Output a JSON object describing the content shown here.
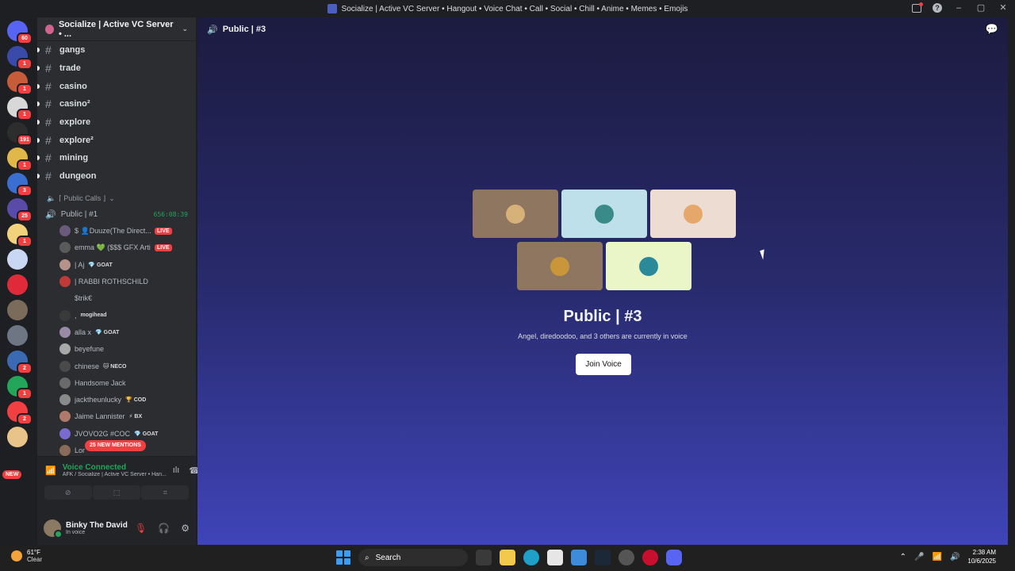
{
  "window": {
    "title": "Socialize | Active VC Server • Hangout • Voice Chat • Call • Social • Chill • Anime • Memes • Emojis"
  },
  "rail": {
    "servers": [
      {
        "name": "home-server",
        "color": "#5865f2",
        "badge": "60"
      },
      {
        "name": "socialize-server",
        "color": "#3a4aa8",
        "badge": "1"
      },
      {
        "name": "server-3",
        "color": "#c75c3b",
        "badge": "1"
      },
      {
        "name": "server-4",
        "color": "#d8d8d8",
        "badge": "1"
      },
      {
        "name": "server-5",
        "color": "#2d2d2d",
        "badge": "191"
      },
      {
        "name": "server-6",
        "color": "#e0b84a",
        "badge": "1"
      },
      {
        "name": "server-7",
        "color": "#3a6fd1",
        "badge": "3"
      },
      {
        "name": "server-8",
        "color": "#5a4ba8",
        "badge": "25"
      },
      {
        "name": "server-9",
        "color": "#f2d27a",
        "badge": "1"
      },
      {
        "name": "server-10",
        "color": "#c9d7f2",
        "badge": ""
      },
      {
        "name": "server-11",
        "color": "#e02a3a",
        "badge": ""
      },
      {
        "name": "server-12",
        "color": "#7a6b5a",
        "badge": ""
      },
      {
        "name": "server-13",
        "color": "#6e7684",
        "badge": ""
      },
      {
        "name": "server-14",
        "color": "#3b6ab2",
        "badge": "2"
      },
      {
        "name": "server-15",
        "color": "#23a55a",
        "badge": "1"
      },
      {
        "name": "server-16",
        "color": "#f23f42",
        "badge": "2"
      },
      {
        "name": "server-17",
        "color": "#e8c38a",
        "badge": ""
      }
    ],
    "new_label": "NEW"
  },
  "sidebar": {
    "server_name": "Socialize | Active VC Server • ...",
    "channels": [
      "gangs",
      "trade",
      "casino",
      "casino²",
      "explore",
      "explore²",
      "mining",
      "dungeon"
    ],
    "category": "⌈ Public Calls ⌋",
    "voice_channel": {
      "name": "Public | #1",
      "time": "656:08:39"
    },
    "members": [
      {
        "name": "$ 👤Duuze(The Direct...",
        "tag": "",
        "live": "LIVE",
        "color": "#6b5b7a"
      },
      {
        "name": "emma 💚 ($$$ GFX Artist)",
        "tag": "",
        "live": "LIVE",
        "color": "#5a5a5a"
      },
      {
        "name": "| Aj",
        "tag": "💎 GOAT",
        "live": "",
        "color": "#b5928a"
      },
      {
        "name": "| RABBI ROTHSCHILD",
        "tag": "",
        "live": "",
        "color": "#c03a3a"
      },
      {
        "name": "$trik€",
        "tag": "",
        "live": "",
        "color": "#2b2d31"
      },
      {
        "name": ",",
        "tag": "mogihead",
        "live": "",
        "color": "#3a3a3a"
      },
      {
        "name": "alla x",
        "tag": "💎 GOAT",
        "live": "",
        "color": "#9a8aa6"
      },
      {
        "name": "beyefune",
        "tag": "",
        "live": "",
        "color": "#a8a8a8"
      },
      {
        "name": "chinese",
        "tag": "🐱 NECO",
        "live": "",
        "color": "#4a4a4a"
      },
      {
        "name": "Handsome Jack",
        "tag": "",
        "live": "",
        "color": "#6a6a6a"
      },
      {
        "name": "jacktheunlucky",
        "tag": "🏆 COD",
        "live": "",
        "color": "#8a8a8a"
      },
      {
        "name": "Jaime Lannister",
        "tag": "⚡ BX",
        "live": "",
        "color": "#b07a6a"
      },
      {
        "name": "JVOVO2G #COC",
        "tag": "💎 GOAT",
        "live": "",
        "color": "#7a6ad0"
      },
      {
        "name": "Lor",
        "tag": "",
        "live": "",
        "color": "#8a6a5a"
      }
    ],
    "new_mentions": "25 NEW MENTIONS"
  },
  "voice_panel": {
    "status": "Voice Connected",
    "location": "AFK / Socialize | Active VC Server • Han..."
  },
  "user_panel": {
    "name": "Binky The David",
    "status": "In voice"
  },
  "main": {
    "channel": "Public | #3",
    "tiles": [
      {
        "bg": "#8e7660",
        "av": "#d6b27a"
      },
      {
        "bg": "#bde0ea",
        "av": "#3a8a8a"
      },
      {
        "bg": "#ecdcd2",
        "av": "#e6a86a"
      },
      {
        "bg": "#8e7660",
        "av": "#c9963a"
      },
      {
        "bg": "#eaf6c8",
        "av": "#2a8a9a"
      }
    ],
    "title": "Public | #3",
    "subtitle": "Angel, diredoodoo, and 3 others are currently in voice",
    "join_label": "Join Voice"
  },
  "taskbar": {
    "temp": "61°F",
    "condition": "Clear",
    "search_label": "Search",
    "time": "2:38 AM",
    "date": "10/6/2025"
  }
}
